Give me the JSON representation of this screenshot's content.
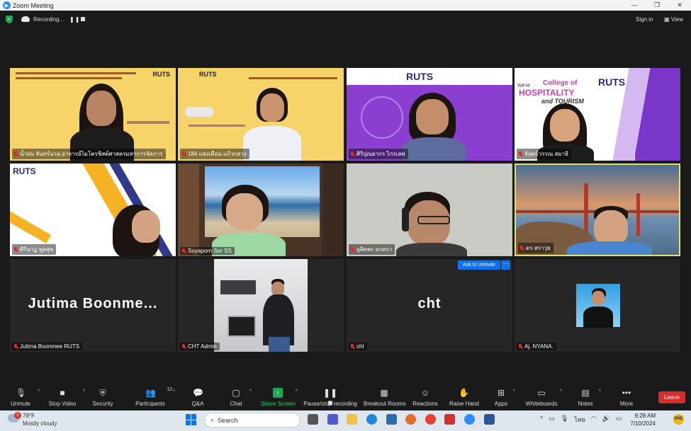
{
  "window": {
    "title": "Zoom Meeting",
    "controls": [
      "—",
      "❐",
      "✕"
    ]
  },
  "meeting_bar": {
    "recording_label": "Recording...",
    "pause_glyph": "❚❚",
    "sign_in": "Sign in",
    "view": "View"
  },
  "tiles": [
    {
      "name": "น้ำฝน จันทร์นวล,อาจารย์ไมโครซิสต์ศาสตรมหาการจัดการ",
      "muted": true,
      "kind": "slide-yellow",
      "slide_brand": "RUTS"
    },
    {
      "name": "184 แสงเดือน แก้วกลาง",
      "muted": true,
      "kind": "slide-yellow",
      "slide_brand": "RUTS"
    },
    {
      "name": "ศิริปุณยากร ไกรเลพ",
      "muted": true,
      "kind": "slide-purple",
      "slide_brand": "RUTS"
    },
    {
      "name": "จันทร์วรรณ สมาธิ",
      "muted": true,
      "kind": "slide-hospitality",
      "slide_brand": "RUTS",
      "slide_text": [
        "We're",
        "College of",
        "HOSPITALITY",
        "and TOURISM"
      ]
    },
    {
      "name": "ศิรินาฏ พูลสุข",
      "muted": true,
      "kind": "slide-white",
      "slide_brand": "RUTS"
    },
    {
      "name": "Suyaporn Sor SS",
      "muted": true,
      "kind": "video-beach"
    },
    {
      "name": "อุสิตพร ยกทรา",
      "muted": true,
      "kind": "video-wall"
    },
    {
      "name": "ดร สราวุธ",
      "muted": true,
      "kind": "video-bridge",
      "active_speaker": true
    },
    {
      "name": "Jutima Boonmee RUTS",
      "muted": true,
      "kind": "name-only",
      "display_name": "Jutima  Boonme..."
    },
    {
      "name": "CHT Admin",
      "muted": true,
      "kind": "video-office"
    },
    {
      "name": "cht",
      "muted": true,
      "kind": "name-only",
      "display_name": "cht"
    },
    {
      "name": "Aj. NYANA.",
      "muted": false,
      "kind": "avatar"
    }
  ],
  "ask_to_unmute": "Ask to Unmute",
  "ask_more": "···",
  "toolbar": {
    "unmute": "Unmute",
    "stop_video": "Stop Video",
    "security": "Security",
    "participants": "Participants",
    "participants_count": "12",
    "qa": "Q&A",
    "chat": "Chat",
    "share_screen": "Share Screen",
    "pause_recording": "Pause/stop recording",
    "breakout_rooms": "Breakout Rooms",
    "reactions": "Reactions",
    "raise_hand": "Raise Hand",
    "apps": "Apps",
    "whiteboards": "Whiteboards",
    "notes": "Notes",
    "more": "More",
    "leave": "Leave"
  },
  "taskbar": {
    "weather_badge": "1",
    "temperature": "79°F",
    "condition": "Mostly cloudy",
    "search_placeholder": "Search",
    "language": "ไทย",
    "time": "9:28 AM",
    "date": "7/10/2024",
    "notif_badge": "PRE"
  },
  "colors": {
    "accent_blue": "#0e72ed",
    "leave_red": "#d32f2f",
    "share_green": "#23a455",
    "active_speaker_border": "#dfe36a"
  }
}
